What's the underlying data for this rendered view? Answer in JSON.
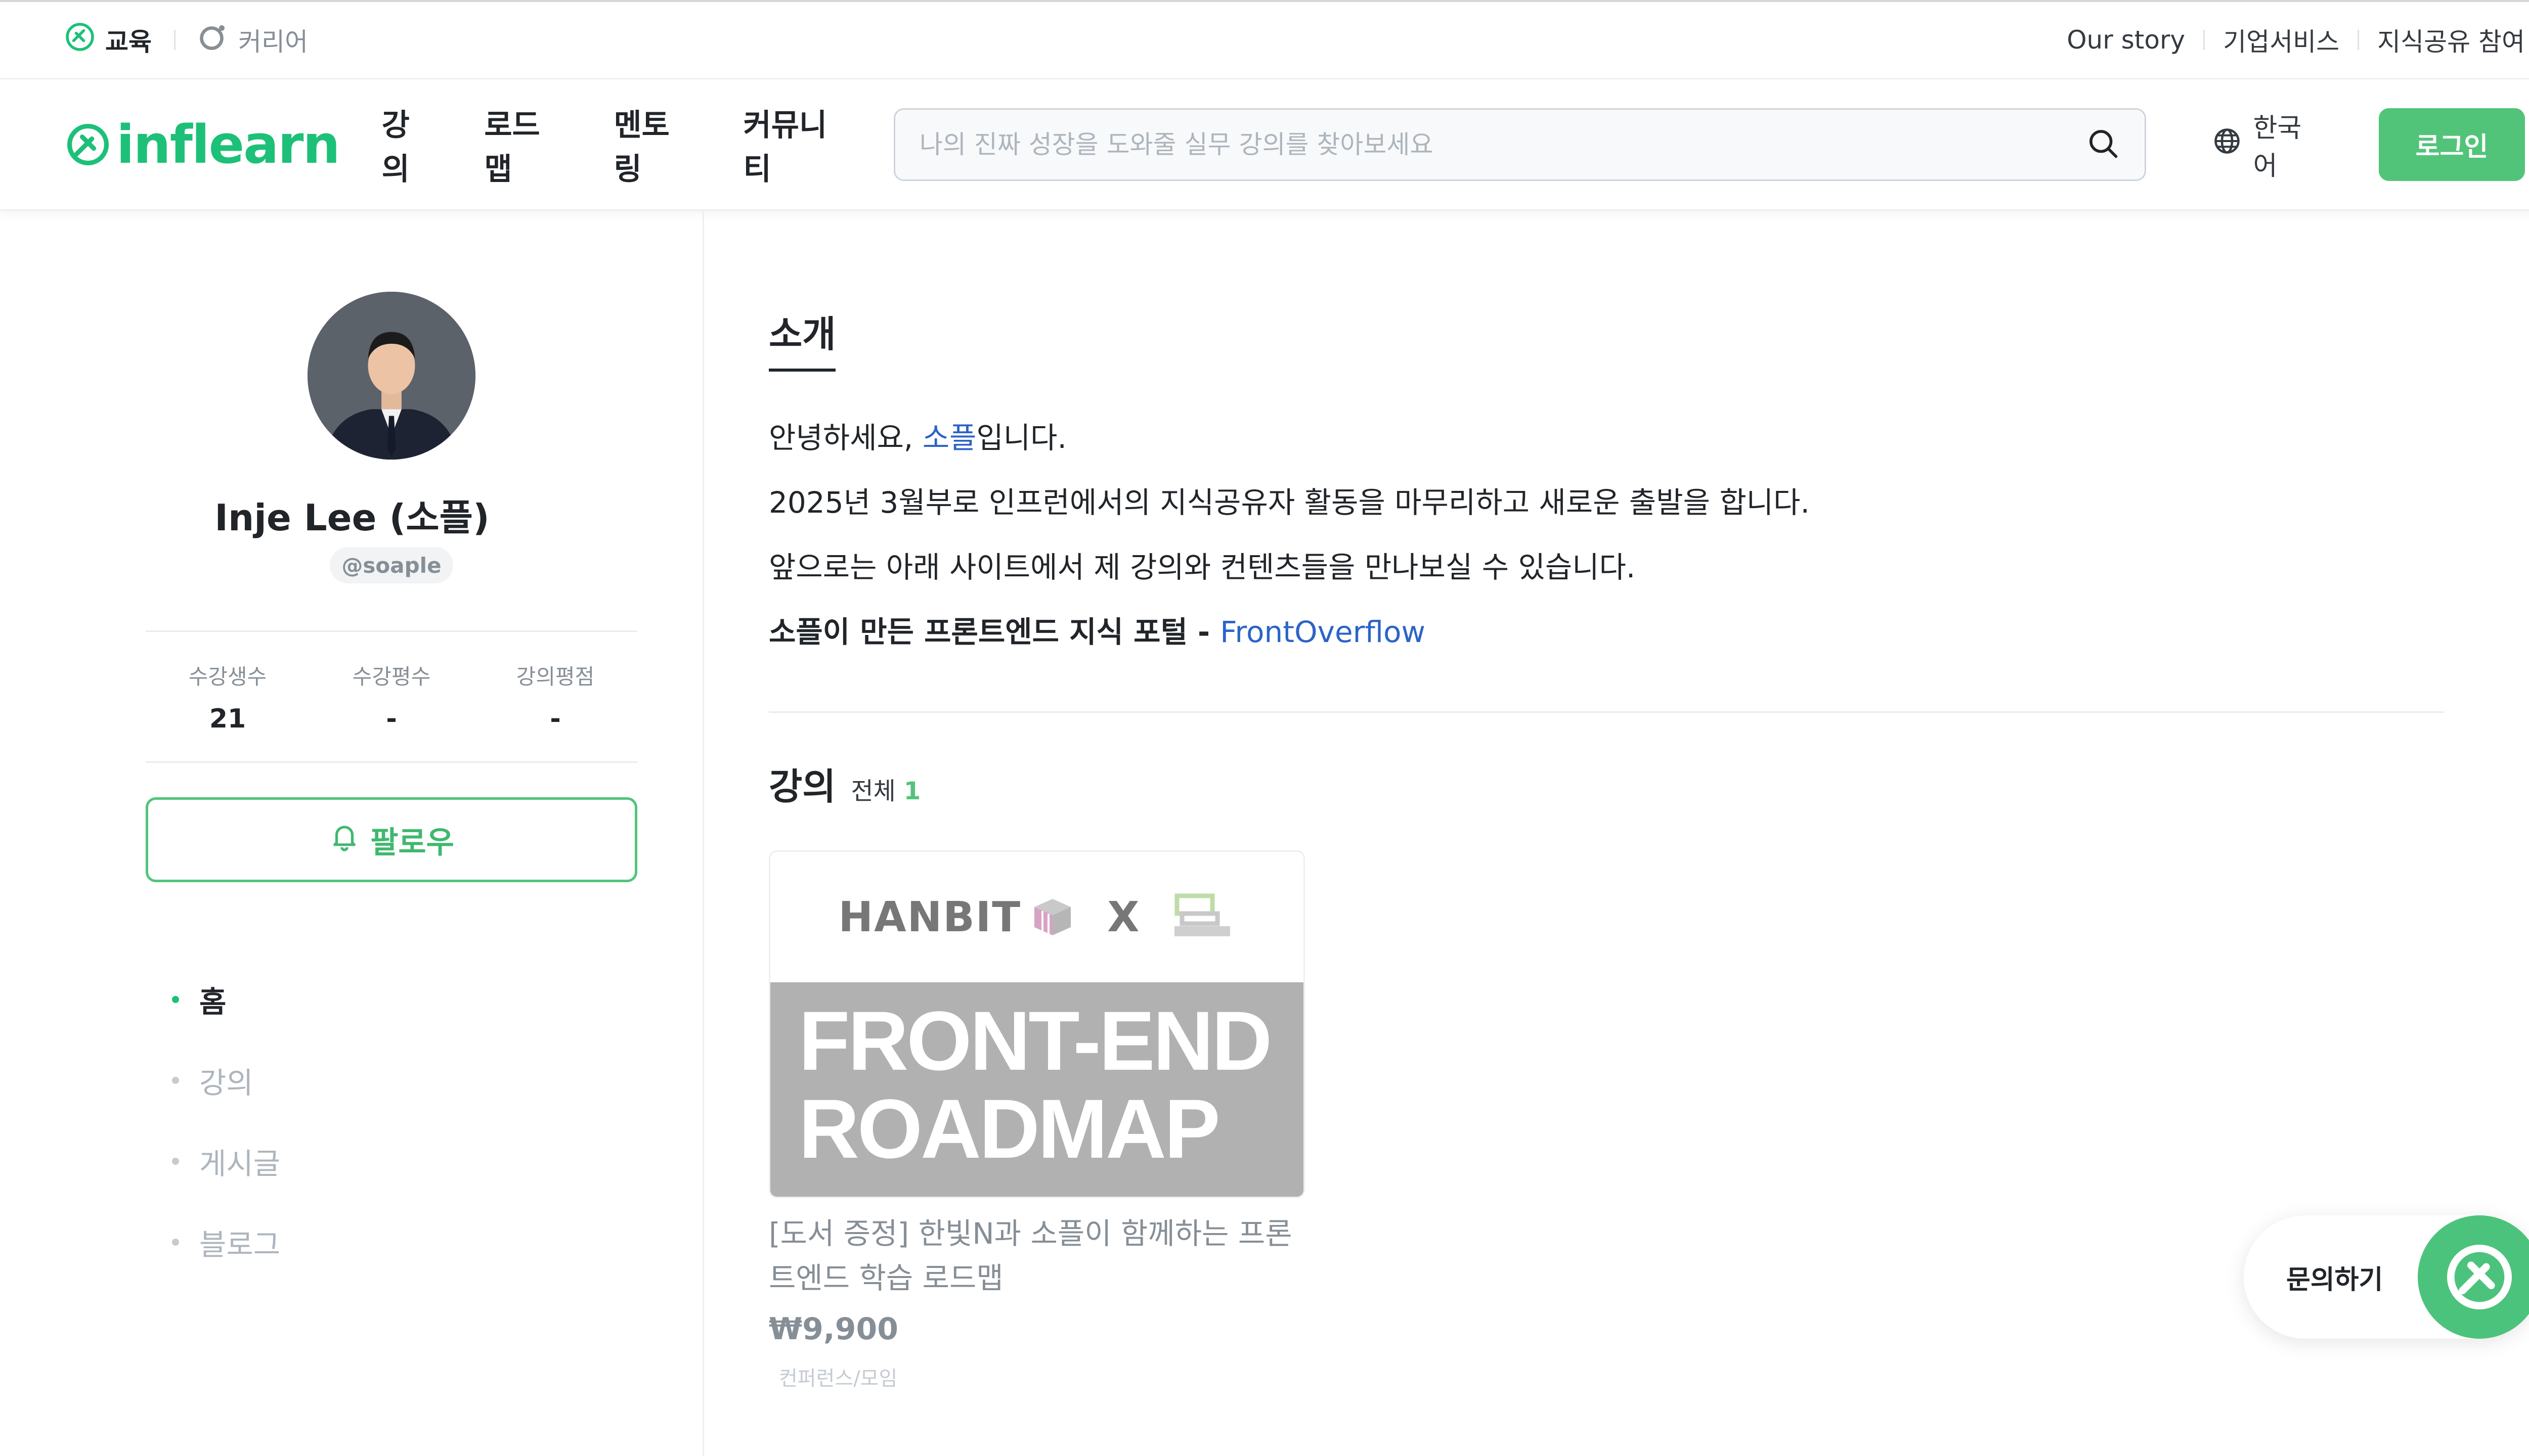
{
  "topbar": {
    "left": [
      {
        "label": "교육",
        "icon": "leaf-icon",
        "active": true
      },
      {
        "label": "커리어",
        "icon": "career-icon",
        "active": false
      }
    ],
    "right": [
      "Our story",
      "기업서비스",
      "지식공유 참여"
    ]
  },
  "nav": {
    "logo": "inflearn",
    "links": [
      "강의",
      "로드맵",
      "멘토링",
      "커뮤니티"
    ],
    "search_placeholder": "나의 진짜 성장을 도와줄 실무 강의를 찾아보세요",
    "language": "한국어",
    "login": "로그인"
  },
  "profile": {
    "name": "Inje Lee (소플)",
    "handle": "@soaple",
    "stats": [
      {
        "label": "수강생수",
        "value": "21"
      },
      {
        "label": "수강평수",
        "value": "-"
      },
      {
        "label": "강의평점",
        "value": "-"
      }
    ],
    "follow": "팔로우",
    "menu": [
      {
        "label": "홈",
        "active": true
      },
      {
        "label": "강의",
        "active": false
      },
      {
        "label": "게시글",
        "active": false
      },
      {
        "label": "블로그",
        "active": false
      }
    ]
  },
  "intro": {
    "title": "소개",
    "line1_a": "안녕하세요, ",
    "line1_link": "소플",
    "line1_b": "입니다.",
    "line2": "2025년 3월부로 인프런에서의 지식공유자 활동을 마무리하고 새로운 출발을 합니다.",
    "line3": "앞으로는 아래 사이트에서 제 강의와 컨텐츠들을 만나보실 수 있습니다.",
    "line4_bold": "소플이 만든 프론트엔드 지식 포털 - ",
    "line4_link": "FrontOverflow"
  },
  "courses": {
    "title": "강의",
    "all_label": "전체",
    "count": "1",
    "items": [
      {
        "thumb_brand": "HANBIT",
        "thumb_x": "X",
        "thumb_line1": "FRONT-END",
        "thumb_line2": "ROADMAP",
        "title": "[도서 증정] 한빛N과 소플이 함께하는 프론트엔드 학습 로드맵",
        "price": "₩9,900",
        "tag": "컨퍼런스/모임"
      }
    ]
  },
  "floating": {
    "label": "문의하기"
  },
  "colors": {
    "brand": "#1dc078",
    "link": "#2b63c8",
    "button": "#52c47a"
  }
}
